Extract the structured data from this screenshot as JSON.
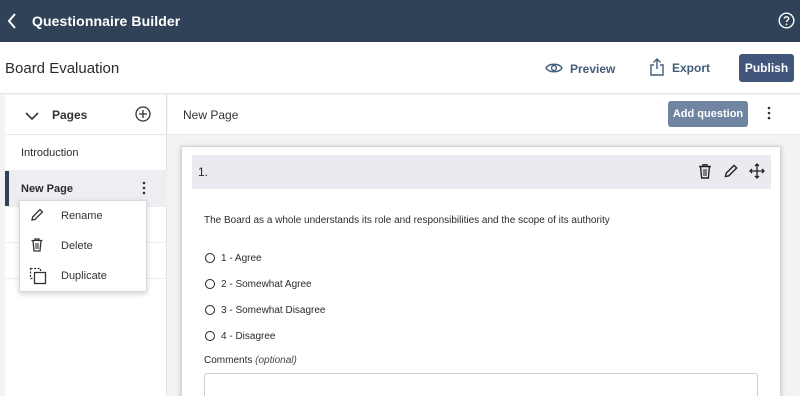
{
  "app": {
    "title": "Questionnaire Builder"
  },
  "header": {
    "doc_title": "Board Evaluation",
    "preview_label": "Preview",
    "export_label": "Export",
    "publish_label": "Publish"
  },
  "pages_panel": {
    "title": "Pages",
    "items": [
      {
        "label": "Introduction",
        "active": false
      },
      {
        "label": "New Page",
        "active": true
      }
    ],
    "context_menu": [
      {
        "label": "Rename",
        "icon": "pencil-icon"
      },
      {
        "label": "Delete",
        "icon": "trash-icon"
      },
      {
        "label": "Duplicate",
        "icon": "duplicate-icon"
      }
    ]
  },
  "main": {
    "page_title": "New Page",
    "add_question_label": "Add question",
    "question": {
      "number": "1.",
      "text": "The Board as a whole understands its role and responsibilities and the scope of its authority",
      "options": [
        "1 - Agree",
        "2 - Somewhat Agree",
        "3 - Somewhat Disagree",
        "4 - Disagree"
      ],
      "comments_label": "Comments",
      "comments_hint": "(optional)"
    }
  },
  "colors": {
    "topbar": "#2f4257",
    "accent": "#42557a",
    "button_muted": "#6f85a1"
  }
}
